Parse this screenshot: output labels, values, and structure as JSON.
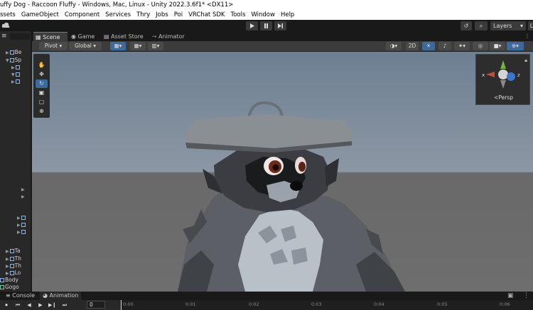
{
  "window": {
    "title": "uffy Dog - Raccoon Fluffy - Windows, Mac, Linux - Unity 2022.3.6f1* <DX11>"
  },
  "menu": [
    "ssets",
    "GameObject",
    "Component",
    "Services",
    "Thry",
    "Jobs",
    "Poi",
    "VRChat SDK",
    "Tools",
    "Window",
    "Help"
  ],
  "toolbar": {
    "play_icon": "play-icon",
    "pause_icon": "pause-icon",
    "step_icon": "step-icon",
    "layers_label": "Layers",
    "layout_label": "L"
  },
  "hierarchy": {
    "rows": [
      {
        "label": "Be",
        "indent": 1
      },
      {
        "label": "Sp",
        "indent": 1
      },
      {
        "label": "",
        "indent": 2
      },
      {
        "label": "",
        "indent": 2
      },
      {
        "label": "",
        "indent": 2
      },
      {
        "label": "Ta",
        "indent": 1
      },
      {
        "label": "Th",
        "indent": 1
      },
      {
        "label": "Th",
        "indent": 1
      },
      {
        "label": "Lo",
        "indent": 1
      },
      {
        "label": "Body",
        "indent": 0
      },
      {
        "label": "Gogo",
        "indent": 0
      }
    ]
  },
  "scene_tabs": [
    {
      "label": "Scene",
      "icon": "grid-icon",
      "active": true
    },
    {
      "label": "Game",
      "icon": "gamepad-icon",
      "active": false
    },
    {
      "label": "Asset Store",
      "icon": "store-icon",
      "active": false
    },
    {
      "label": "Animator",
      "icon": "animator-icon",
      "active": false
    }
  ],
  "scene_toolbar": {
    "pivot": "Pivot",
    "global": "Global",
    "mode_2d": "2D"
  },
  "gizmo": {
    "persp": "Persp",
    "x": "x",
    "z": "z"
  },
  "bottom_tabs": [
    {
      "label": "Console",
      "active": false
    },
    {
      "label": "Animation",
      "active": true
    }
  ],
  "animation": {
    "frame": "0",
    "ruler": [
      "0:00",
      "0:01",
      "0:02",
      "0:03",
      "0:04",
      "0:05",
      "0:06"
    ]
  },
  "colors": {
    "accent": "#3d6a9e",
    "sky_top": "#6d7f92",
    "ground": "#6e6e6e"
  }
}
